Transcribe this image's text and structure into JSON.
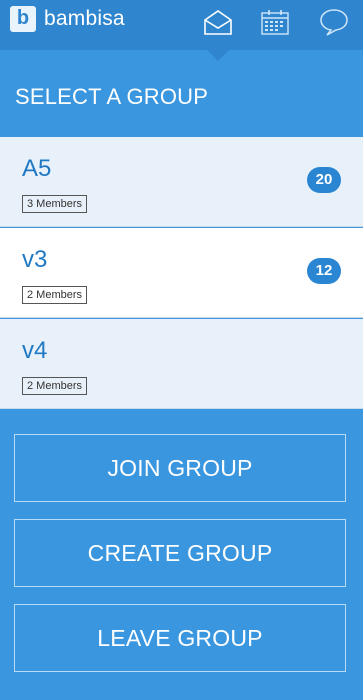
{
  "header": {
    "logo_letter": "b",
    "brand": "bambisa",
    "icons": [
      "envelope-icon",
      "calendar-icon",
      "chat-bubble-icon"
    ]
  },
  "section": {
    "title": "SELECT A GROUP"
  },
  "groups": [
    {
      "name": "A5",
      "members": "3 Members",
      "count": "20"
    },
    {
      "name": "v3",
      "members": "2 Members",
      "count": "12"
    },
    {
      "name": "v4",
      "members": "2 Members",
      "count": ""
    }
  ],
  "actions": {
    "join": "JOIN GROUP",
    "create": "CREATE GROUP",
    "leave": "LEAVE GROUP"
  },
  "colors": {
    "header": "#2f86cf",
    "background": "#3a96de",
    "accent_text": "#2179c4",
    "badge": "#2a86d2"
  }
}
